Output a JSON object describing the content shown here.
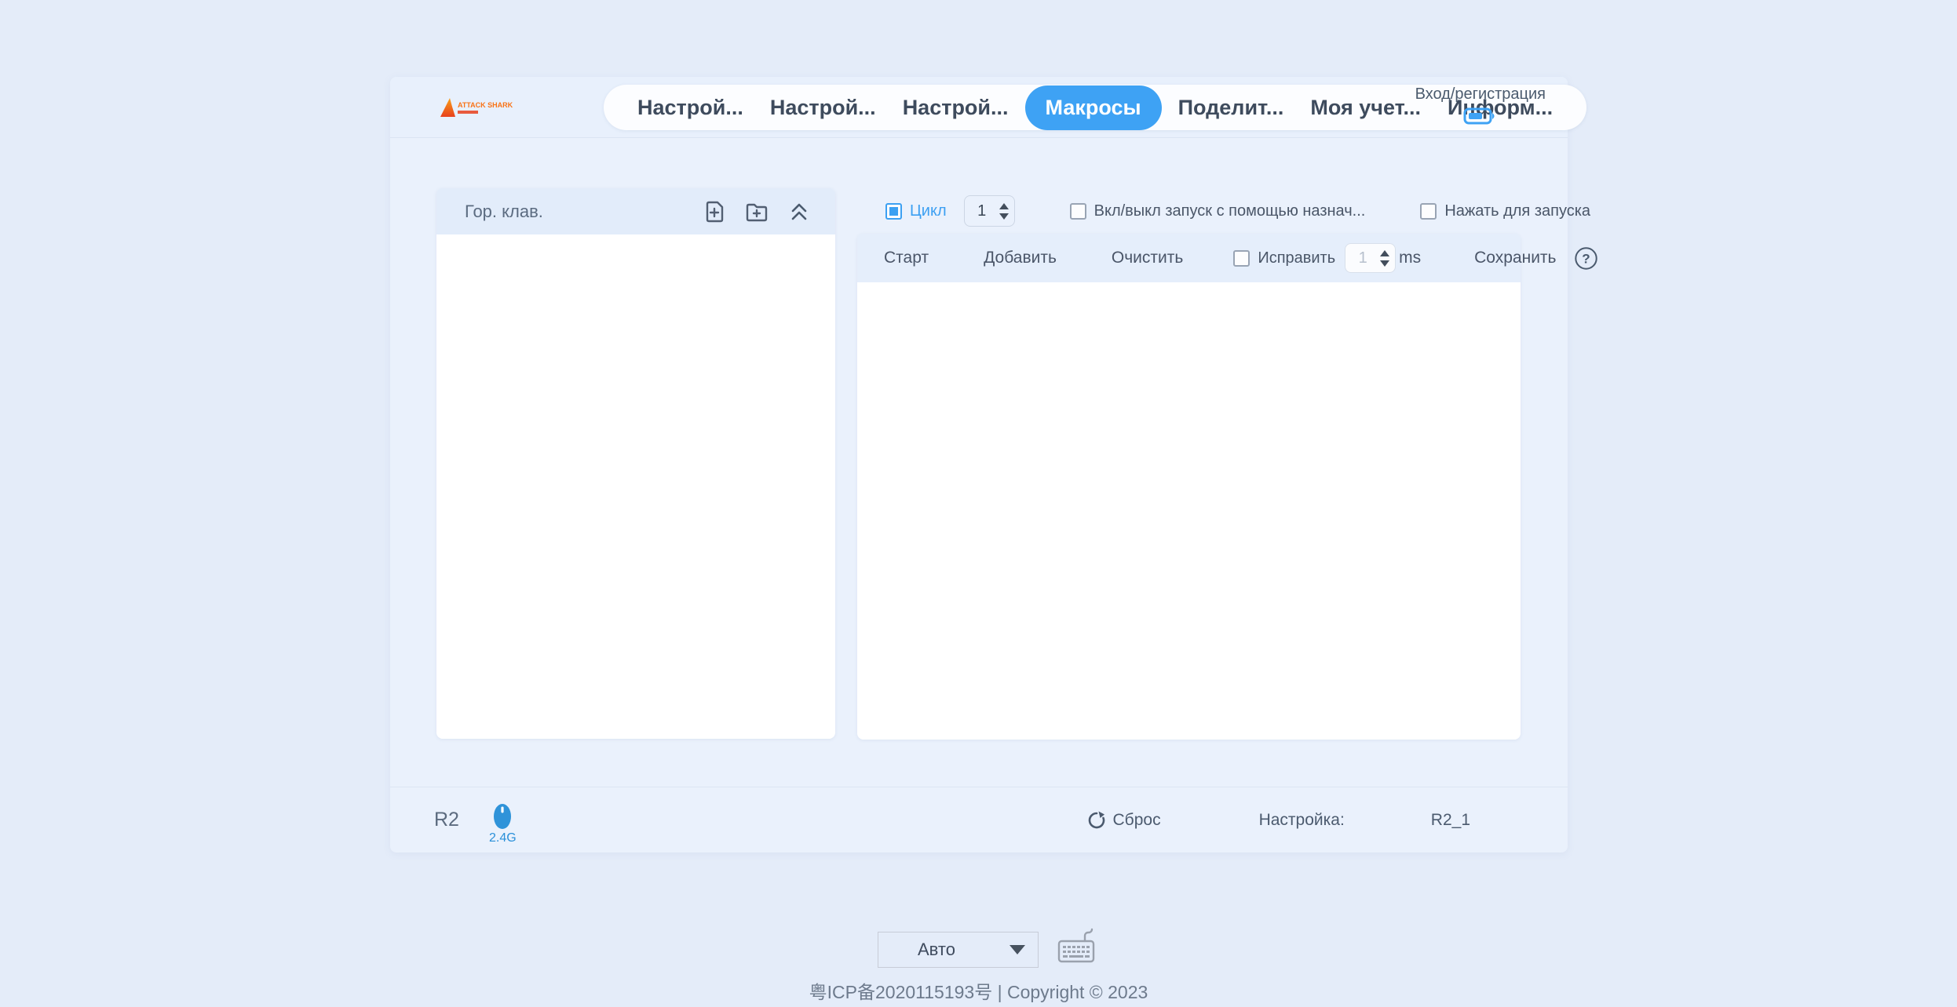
{
  "brand": {
    "logo_text": "ATTACK SHARK"
  },
  "header": {
    "login_label": "Вход/регистрация",
    "nav": {
      "active_index": 3,
      "tabs": [
        {
          "label": "Настрой..."
        },
        {
          "label": "Настрой..."
        },
        {
          "label": "Настрой..."
        },
        {
          "label": "Макросы"
        },
        {
          "label": "Поделит..."
        },
        {
          "label": "Моя учет..."
        },
        {
          "label": "Информ..."
        }
      ]
    }
  },
  "left_panel": {
    "title": "Гор. клав."
  },
  "macro_controls": {
    "loop_label": "Цикл",
    "loop_checked": true,
    "loop_value": "1",
    "toggle_assign_label": "Вкл/выкл запуск с помощью назнач...",
    "press_to_run_label": "Нажать для запуска"
  },
  "toolbar": {
    "start_label": "Старт",
    "add_label": "Добавить",
    "clear_label": "Очистить",
    "fix_label": "Исправить",
    "fix_checked": false,
    "fix_value": "1",
    "ms_label": "ms",
    "save_label": "Сохранить"
  },
  "status_bar": {
    "device_name": "R2",
    "connection": "2.4G",
    "reset_label": "Сброс",
    "profile_label": "Настройка:",
    "profile_value": "R2_1"
  },
  "footer": {
    "mode_value": "Авто",
    "copyright": "粤ICP备2020115193号 | Copyright © 2023"
  },
  "icons": {
    "help_glyph": "?",
    "names": [
      "file-add-icon",
      "folder-add-icon",
      "collapse-up-icon",
      "battery-icon",
      "mouse-icon",
      "refresh-icon",
      "help-icon",
      "keyboard-icon",
      "dropdown-caret-icon"
    ]
  },
  "colors": {
    "accent_blue": "#3ea2f4",
    "mouse_blue": "#2f93d9",
    "logo_orange": "#f97316",
    "page_bg": "#e4ecf9",
    "card_bg": "#eaf1fc",
    "panel_header_bg": "#e2ecfa"
  }
}
